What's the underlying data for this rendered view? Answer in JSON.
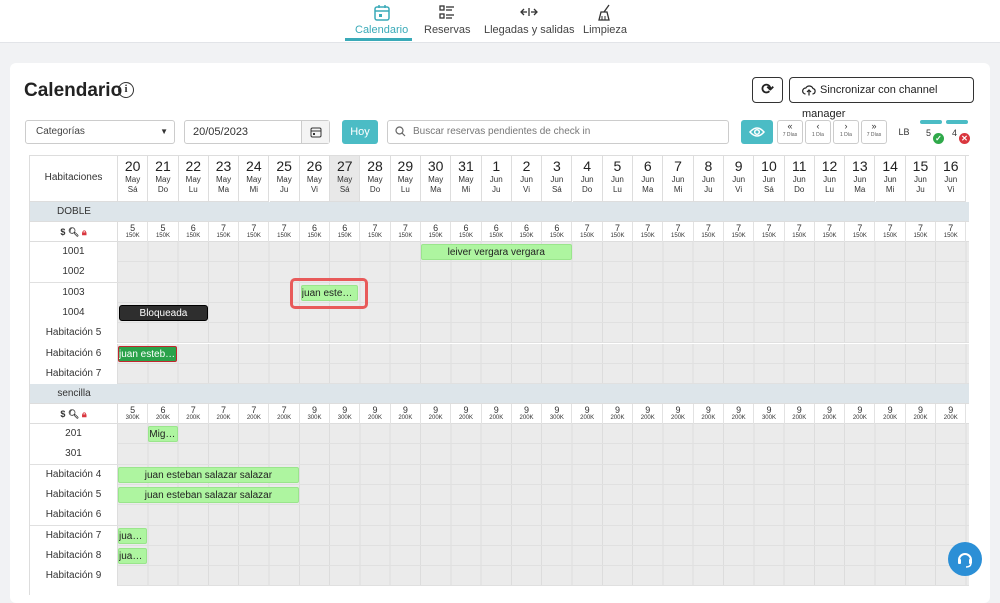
{
  "tabs": [
    {
      "label": "Calendario",
      "icon": "calendar-icon"
    },
    {
      "label": "Reservas",
      "icon": "list-icon"
    },
    {
      "label": "Llegadas y salidas",
      "icon": "arrows-icon"
    },
    {
      "label": "Limpieza",
      "icon": "broom-icon"
    }
  ],
  "header": {
    "title": "Calendario",
    "info": "i",
    "sync_label": "Sincronizar con channel manager"
  },
  "filters": {
    "category": "Categorías",
    "date": "20/05/2023",
    "today": "Hoy",
    "search_placeholder": "Buscar reservas pendientes de check in"
  },
  "nav": [
    {
      "arrow": "«",
      "sub": "7 Días"
    },
    {
      "arrow": "‹",
      "sub": "1 Día"
    },
    {
      "arrow": "›",
      "sub": "1 Día"
    },
    {
      "arrow": "»",
      "sub": "7 Días"
    }
  ],
  "lb": "LB",
  "count_ok": "5",
  "count_bad": "4",
  "rooms_header": "Habitaciones",
  "days": [
    [
      "20",
      "May",
      "Sá"
    ],
    [
      "21",
      "May",
      "Do"
    ],
    [
      "22",
      "May",
      "Lu"
    ],
    [
      "23",
      "May",
      "Ma"
    ],
    [
      "24",
      "May",
      "Mi"
    ],
    [
      "25",
      "May",
      "Ju"
    ],
    [
      "26",
      "May",
      "Vi"
    ],
    [
      "27",
      "May",
      "Sá"
    ],
    [
      "28",
      "May",
      "Do"
    ],
    [
      "29",
      "May",
      "Lu"
    ],
    [
      "30",
      "May",
      "Ma"
    ],
    [
      "31",
      "May",
      "Mi"
    ],
    [
      "1",
      "Jun",
      "Ju"
    ],
    [
      "2",
      "Jun",
      "Vi"
    ],
    [
      "3",
      "Jun",
      "Sá"
    ],
    [
      "4",
      "Jun",
      "Do"
    ],
    [
      "5",
      "Jun",
      "Lu"
    ],
    [
      "6",
      "Jun",
      "Ma"
    ],
    [
      "7",
      "Jun",
      "Mi"
    ],
    [
      "8",
      "Jun",
      "Ju"
    ],
    [
      "9",
      "Jun",
      "Vi"
    ],
    [
      "10",
      "Jun",
      "Sá"
    ],
    [
      "11",
      "Jun",
      "Do"
    ],
    [
      "12",
      "Jun",
      "Lu"
    ],
    [
      "13",
      "Jun",
      "Ma"
    ],
    [
      "14",
      "Jun",
      "Mi"
    ],
    [
      "15",
      "Jun",
      "Ju"
    ],
    [
      "16",
      "Jun",
      "Vi"
    ]
  ],
  "sections": [
    {
      "name": "DOBLE",
      "avail": [
        "5",
        "5",
        "6",
        "7",
        "7",
        "7",
        "6",
        "6",
        "7",
        "7",
        "6",
        "6",
        "6",
        "6",
        "6",
        "7",
        "7",
        "7",
        "7",
        "7",
        "7",
        "7",
        "7",
        "7",
        "7",
        "7",
        "7",
        "7"
      ],
      "price": "150K",
      "rooms": [
        "1001",
        "1002",
        "1003",
        "1004",
        "Habitación 5",
        "Habitación 6",
        "Habitación 7"
      ]
    },
    {
      "name": "sencilla",
      "avail": [
        "5",
        "6",
        "7",
        "7",
        "7",
        "7",
        "9",
        "9",
        "9",
        "9",
        "9",
        "9",
        "9",
        "9",
        "9",
        "9",
        "9",
        "9",
        "9",
        "9",
        "9",
        "9",
        "9",
        "9",
        "9",
        "9",
        "9",
        "9"
      ],
      "prices": [
        "300K",
        "200K",
        "200K",
        "200K",
        "200K",
        "200K",
        "300K",
        "300K",
        "200K",
        "200K",
        "200K",
        "200K",
        "200K",
        "200K",
        "300K",
        "200K",
        "200K",
        "200K",
        "200K",
        "200K",
        "200K",
        "300K",
        "200K",
        "200K",
        "200K",
        "200K",
        "200K",
        "200K"
      ],
      "rooms": [
        "201",
        "301",
        "Habitación 4",
        "Habitación 5",
        "Habitación 6",
        "Habitación 7",
        "Habitación 8",
        "Habitación 9"
      ]
    }
  ],
  "bookings": {
    "b1": "leiver vergara vergara",
    "b2": "juan esteban salazar salazar",
    "b3": "Bloqueada",
    "b4": "juan esteban salazar salazar",
    "b5": "Miguel",
    "b6": "juan esteban salazar salazar",
    "b7": "juan esteban salazar salazar",
    "b8": "juan esteban salazar salazar",
    "b9": "juan esteban salazar salazar"
  },
  "colors": {
    "accent": "#4bbcc5",
    "booking": "#aef5a0",
    "blocked": "#2e2e2e",
    "highlight": "#e85a5a"
  }
}
